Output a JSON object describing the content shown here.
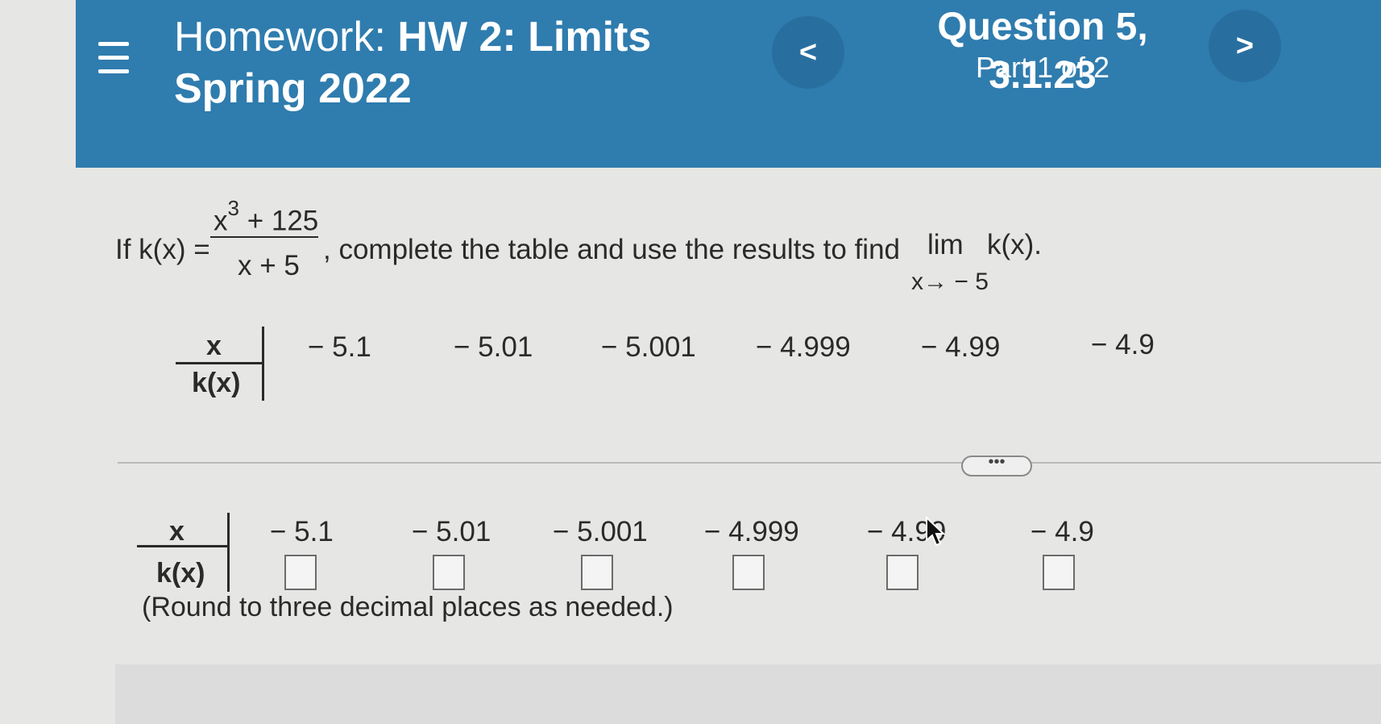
{
  "header": {
    "homework_prefix": "Homework: ",
    "homework_name": "HW 2: Limits",
    "term": "Spring 2022",
    "question_title": "Question 5, 3.1.23",
    "part_label": "Part 1 of 2",
    "prev_label": "<",
    "next_label": ">"
  },
  "problem": {
    "prefix": "If k(x) =",
    "numerator_base": "x",
    "numerator_exp": "3",
    "numerator_rest": "+ 125",
    "denominator": "x + 5",
    "suffix": ", complete the table and use the results to find",
    "lim": "lim",
    "lim_func": "k(x).",
    "lim_sub": "x→ − 5"
  },
  "table": {
    "row_x": "x",
    "row_k": "k(x)",
    "values": [
      "− 5.1",
      "− 5.01",
      "− 5.001",
      "− 4.999",
      "− 4.99",
      "− 4.9"
    ]
  },
  "more_label": "•••",
  "answer": {
    "row_x": "x",
    "row_k": "k(x)",
    "values": [
      "− 5.1",
      "− 5.01",
      "− 5.001",
      "− 4.999",
      "− 4.99",
      "− 4.9"
    ],
    "inputs": [
      "",
      "",
      "",
      "",
      "",
      ""
    ],
    "note": "(Round to three decimal places as needed.)"
  }
}
